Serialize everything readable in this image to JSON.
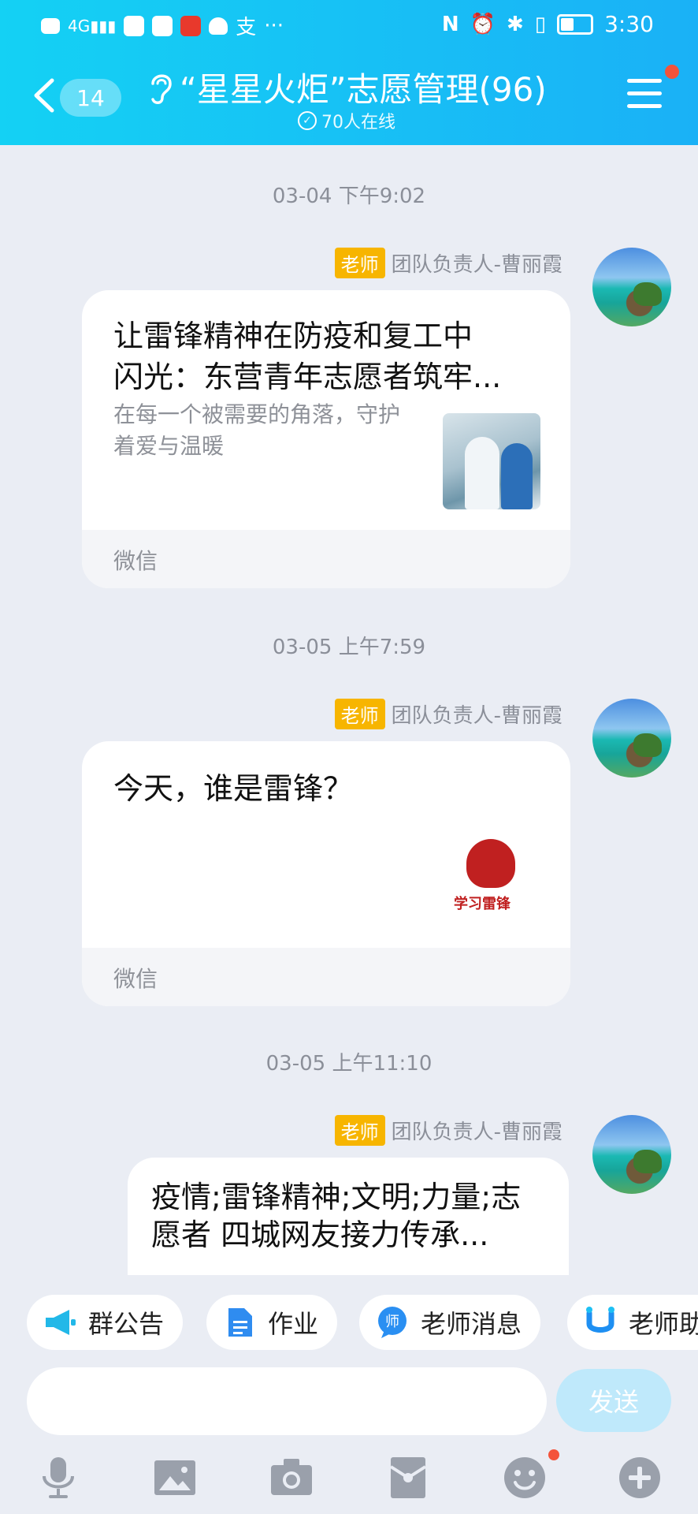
{
  "status_bar": {
    "left_icons": [
      "hd-icon",
      "4g-signal-icon",
      "app-icon",
      "app-icon",
      "app-icon",
      "cloud-icon",
      "alipay-icon",
      "more-icon"
    ],
    "network": "4G",
    "more": "···",
    "alipay": "支",
    "right_icons": [
      "nfc-icon",
      "alarm-icon",
      "bluetooth-icon",
      "vibrate-icon",
      "battery-icon"
    ],
    "nfc": "N",
    "time": "3:30"
  },
  "header": {
    "unread_count": "14",
    "title": "“星星火炬”志愿管理(96)",
    "online": "70人在线",
    "menu_badge_color": "#f4533a"
  },
  "messages": [
    {
      "timestamp": "03-04 下午9:02",
      "role_tag": "老师",
      "sender": "团队负责人-曹丽霞",
      "card": {
        "title_line1": "让雷锋精神在防疫和复工中",
        "title_line2": "闪光：东营青年志愿者筑牢...",
        "desc": "在每一个被需要的角落，守护着爱与温暖",
        "source": "微信"
      }
    },
    {
      "timestamp": "03-05 上午7:59",
      "role_tag": "老师",
      "sender": "团队负责人-曹丽霞",
      "card": {
        "title": "今天，谁是雷锋？",
        "thumb_text": "学习雷锋",
        "source": "微信"
      }
    },
    {
      "timestamp": "03-05 上午11:10",
      "role_tag": "老师",
      "sender": "团队负责人-曹丽霞",
      "bubble": {
        "line1": "疫情;雷锋精神;文明;力量;志",
        "line2": "愿者 四城网友接力传承..."
      }
    }
  ],
  "quick_actions": [
    {
      "label": "群公告",
      "icon": "megaphone-icon"
    },
    {
      "label": "作业",
      "icon": "document-icon"
    },
    {
      "label": "老师消息",
      "icon": "teacher-message-icon"
    },
    {
      "label": "老师助",
      "icon": "teacher-assistant-icon"
    }
  ],
  "composer": {
    "send_label": "发送",
    "tools": [
      "microphone-icon",
      "image-icon",
      "camera-icon",
      "red-packet-icon",
      "emoji-icon",
      "plus-icon"
    ]
  },
  "colors": {
    "header_gradient_start": "#14d1f4",
    "header_gradient_end": "#1ab1f6",
    "role_tag": "#f7b500",
    "background": "#eaedf4",
    "send_button": "#bfe9fb"
  }
}
